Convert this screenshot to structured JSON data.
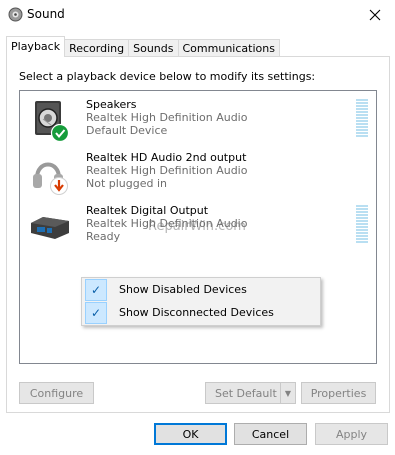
{
  "window": {
    "title": "Sound"
  },
  "tabs": [
    {
      "label": "Playback",
      "active": true
    },
    {
      "label": "Recording",
      "active": false
    },
    {
      "label": "Sounds",
      "active": false
    },
    {
      "label": "Communications",
      "active": false
    }
  ],
  "instruction": "Select a playback device below to modify its settings:",
  "devices": [
    {
      "name": "Speakers",
      "driver": "Realtek High Definition Audio",
      "status": "Default Device",
      "icon": "speaker-icon",
      "badge": "green-check-icon"
    },
    {
      "name": "Realtek HD Audio 2nd output",
      "driver": "Realtek High Definition Audio",
      "status": "Not plugged in",
      "icon": "headphones-icon",
      "badge": "red-down-arrow-icon"
    },
    {
      "name": "Realtek Digital Output",
      "driver": "Realtek High Definition Audio",
      "status": "Ready",
      "icon": "digital-output-icon"
    }
  ],
  "watermark": "RepairWin.com",
  "context_menu": {
    "items": [
      {
        "label": "Show Disabled Devices",
        "checked": true
      },
      {
        "label": "Show Disconnected Devices",
        "checked": true
      }
    ]
  },
  "panel_buttons": {
    "configure": "Configure",
    "set_default": "Set Default",
    "properties": "Properties"
  },
  "dialog_buttons": {
    "ok": "OK",
    "cancel": "Cancel",
    "apply": "Apply"
  },
  "colors": {
    "accent": "#0078d7",
    "check_green": "#169c3b",
    "unplugged_red": "#d83b01",
    "meter": "#b9dff2"
  }
}
